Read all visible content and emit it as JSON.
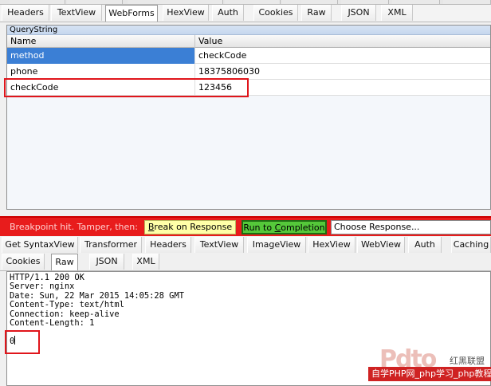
{
  "top_tabs": [
    "Headers",
    "TextView",
    "WebForms",
    "HexView",
    "Auth",
    "Cookies",
    "Raw",
    "JSON",
    "XML"
  ],
  "top_tabs_selected": "WebForms",
  "query_panel": {
    "title": "QueryString",
    "columns": [
      "Name",
      "Value"
    ],
    "rows": [
      {
        "name": "method",
        "value": "checkCode"
      },
      {
        "name": "phone",
        "value": "18375806030"
      },
      {
        "name": "checkCode",
        "value": "123456"
      }
    ],
    "selected_row": "method"
  },
  "breakpoint": {
    "message": "Breakpoint hit. Tamper, then:",
    "break_button": "Break on Response",
    "run_button": "Run to Completion",
    "choose_response": "Choose Response..."
  },
  "bottom_tabs_row1": [
    "Get SyntaxView",
    "Transformer",
    "Headers",
    "TextView",
    "ImageView",
    "HexView",
    "WebView",
    "Auth",
    "Caching"
  ],
  "bottom_tabs_row2": [
    "Cookies",
    "Raw",
    "JSON",
    "XML"
  ],
  "bottom_tabs_selected": "Raw",
  "response": {
    "headers": [
      "HTTP/1.1 200 OK",
      "Server: nginx",
      "Date: Sun, 22 Mar 2015 14:05:28 GMT",
      "Content-Type: text/html",
      "Connection: keep-alive",
      "Content-Length: 1"
    ],
    "body": "0"
  },
  "watermark": {
    "logo": "Pdto",
    "sub": "红黑联盟",
    "bar": "自学PHP网_php学习_php教程"
  },
  "colors": {
    "breakpoint_bar": "#e81c1c",
    "run_button": "#55c83a",
    "break_button": "#ffffa8",
    "selection": "#3b7fd5",
    "highlight_box": "#e0151b"
  }
}
